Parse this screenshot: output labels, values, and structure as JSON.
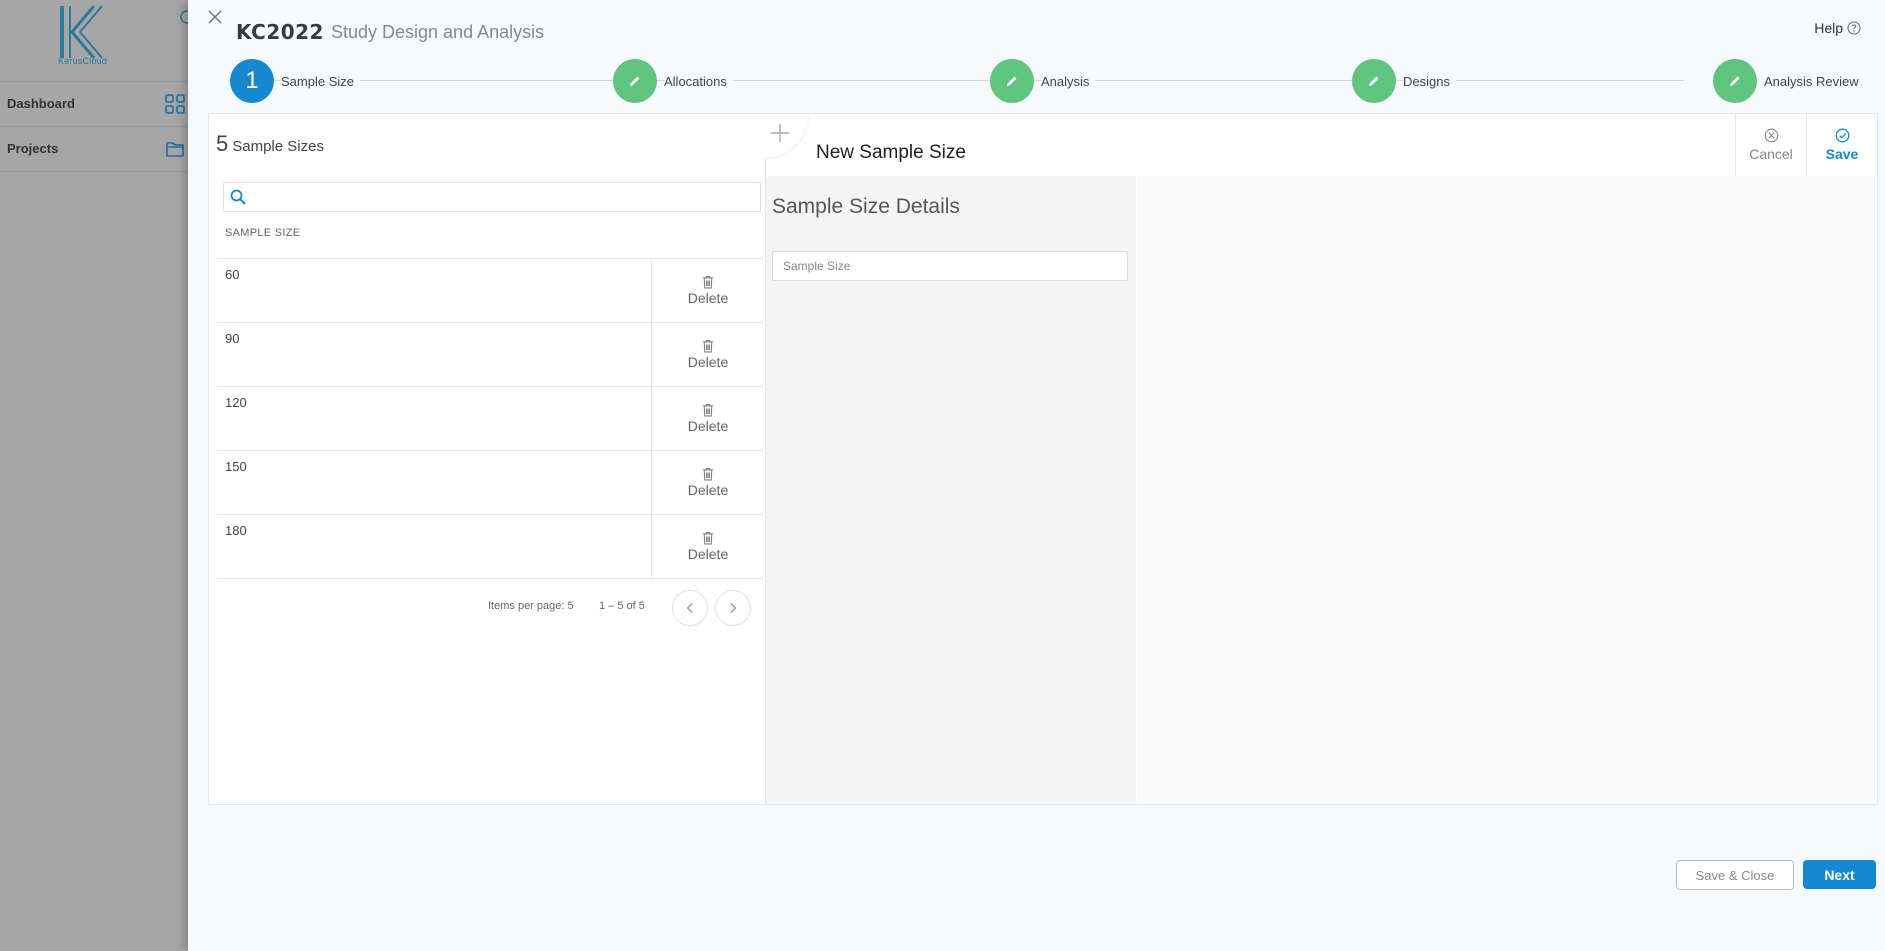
{
  "background": {
    "logo_text": "KerusCloud",
    "nav": [
      {
        "label": "Dashboard",
        "icon": "grid-icon"
      },
      {
        "label": "Projects",
        "icon": "folder-icon"
      }
    ]
  },
  "header": {
    "project_code": "KC2022",
    "subtitle": "Study Design and Analysis",
    "help_label": "Help"
  },
  "stepper": {
    "steps": [
      {
        "label": "Sample Size",
        "number": "1",
        "state": "active"
      },
      {
        "label": "Allocations",
        "state": "done"
      },
      {
        "label": "Analysis",
        "state": "done"
      },
      {
        "label": "Designs",
        "state": "done"
      },
      {
        "label": "Analysis Review",
        "state": "done"
      }
    ]
  },
  "list": {
    "count": "5",
    "title": "Sample Sizes",
    "search_placeholder": "",
    "column_header": "SAMPLE SIZE",
    "delete_label": "Delete",
    "rows": [
      {
        "value": "60"
      },
      {
        "value": "90"
      },
      {
        "value": "120"
      },
      {
        "value": "150"
      },
      {
        "value": "180"
      }
    ],
    "paginator": {
      "items_per_page": "Items per page: 5",
      "range": "1 – 5 of 5"
    }
  },
  "editor": {
    "title": "New Sample Size",
    "details_title": "Sample Size Details",
    "field_placeholder": "Sample Size",
    "cancel_label": "Cancel",
    "save_label": "Save"
  },
  "footer": {
    "save_close_label": "Save & Close",
    "next_label": "Next"
  },
  "colors": {
    "primary": "#1688d0",
    "step_done": "#5ec47e",
    "overlay": "#a6a6a6"
  }
}
